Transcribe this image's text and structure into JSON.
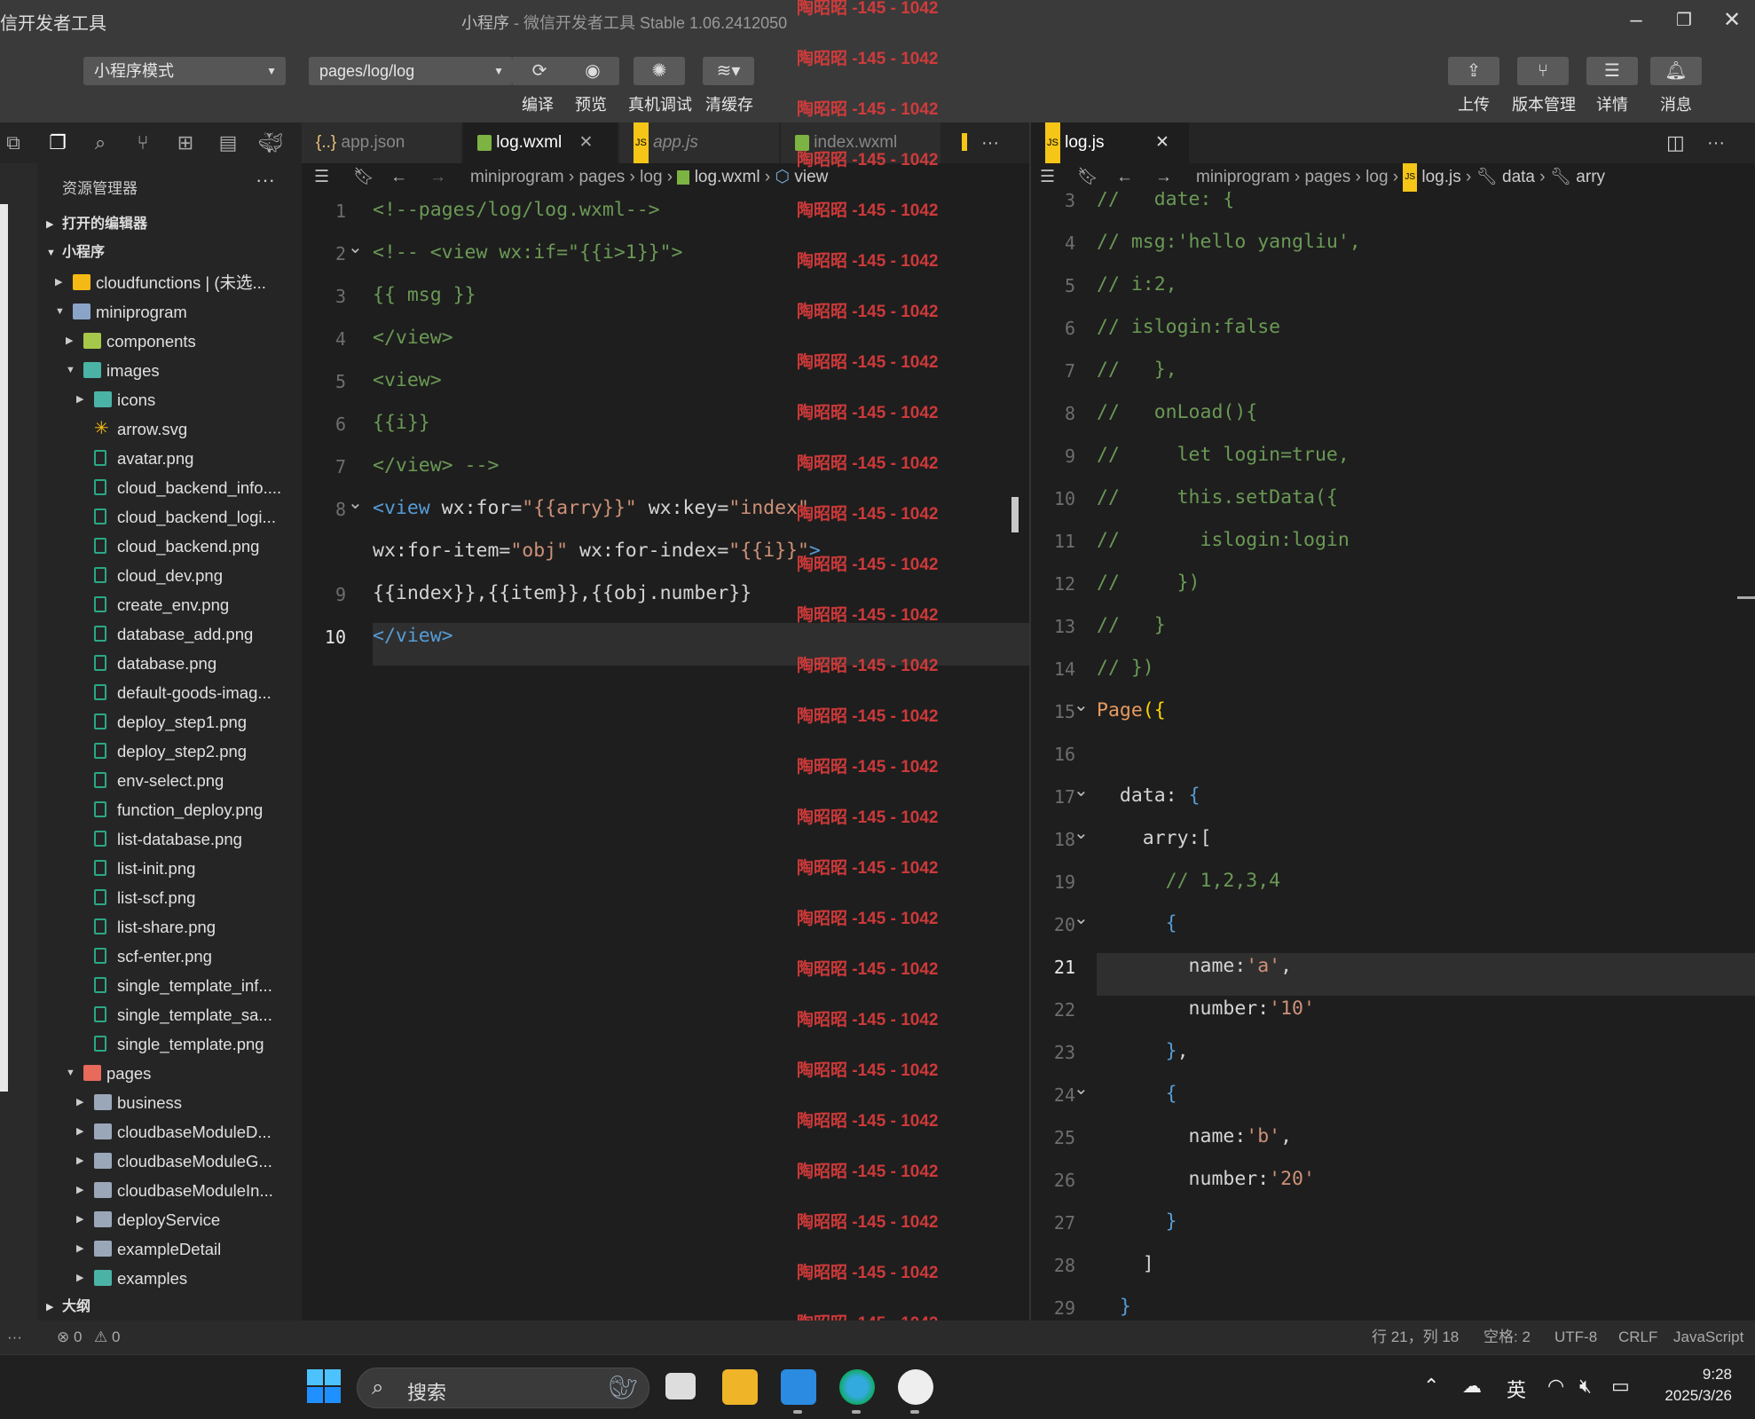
{
  "window": {
    "app_name": "信开发者工具",
    "title_main": "小程序",
    "title_sep": " - ",
    "title_sub": "微信开发者工具 Stable 1.06.2412050"
  },
  "toolbar": {
    "mode_select": "小程序模式",
    "page_select": "pages/log/log",
    "left_buttons": [
      {
        "label": "编译",
        "icon": "refresh-icon"
      },
      {
        "label": "预览",
        "icon": "eye-icon"
      },
      {
        "label": "真机调试",
        "icon": "bug-icon"
      },
      {
        "label": "清缓存",
        "icon": "layers-icon"
      }
    ],
    "right_buttons": [
      {
        "label": "上传",
        "icon": "upload-icon"
      },
      {
        "label": "版本管理",
        "icon": "branch-icon"
      },
      {
        "label": "详情",
        "icon": "menu-icon"
      },
      {
        "label": "消息",
        "icon": "bell-icon"
      }
    ]
  },
  "sidebar": {
    "title": "资源管理器",
    "more": "···",
    "open_editors": "打开的编辑器",
    "project": "小程序",
    "outline": "大纲",
    "tree": [
      {
        "label": "cloudfunctions | (未选...",
        "depth": 1,
        "twisty": "▶",
        "icon": "folder-yellow"
      },
      {
        "label": "miniprogram",
        "depth": 1,
        "twisty": "▼",
        "icon": "folder-open"
      },
      {
        "label": "components",
        "depth": 2,
        "twisty": "▶",
        "icon": "folder-green"
      },
      {
        "label": "images",
        "depth": 2,
        "twisty": "▼",
        "icon": "folder-teal"
      },
      {
        "label": "icons",
        "depth": 3,
        "twisty": "▶",
        "icon": "folder-teal"
      },
      {
        "label": "arrow.svg",
        "depth": 3,
        "twisty": "",
        "icon": "svg"
      },
      {
        "label": "avatar.png",
        "depth": 3,
        "twisty": "",
        "icon": "image"
      },
      {
        "label": "cloud_backend_info....",
        "depth": 3,
        "twisty": "",
        "icon": "image"
      },
      {
        "label": "cloud_backend_logi...",
        "depth": 3,
        "twisty": "",
        "icon": "image"
      },
      {
        "label": "cloud_backend.png",
        "depth": 3,
        "twisty": "",
        "icon": "image"
      },
      {
        "label": "cloud_dev.png",
        "depth": 3,
        "twisty": "",
        "icon": "image"
      },
      {
        "label": "create_env.png",
        "depth": 3,
        "twisty": "",
        "icon": "image"
      },
      {
        "label": "database_add.png",
        "depth": 3,
        "twisty": "",
        "icon": "image"
      },
      {
        "label": "database.png",
        "depth": 3,
        "twisty": "",
        "icon": "image"
      },
      {
        "label": "default-goods-imag...",
        "depth": 3,
        "twisty": "",
        "icon": "image"
      },
      {
        "label": "deploy_step1.png",
        "depth": 3,
        "twisty": "",
        "icon": "image"
      },
      {
        "label": "deploy_step2.png",
        "depth": 3,
        "twisty": "",
        "icon": "image"
      },
      {
        "label": "env-select.png",
        "depth": 3,
        "twisty": "",
        "icon": "image"
      },
      {
        "label": "function_deploy.png",
        "depth": 3,
        "twisty": "",
        "icon": "image"
      },
      {
        "label": "list-database.png",
        "depth": 3,
        "twisty": "",
        "icon": "image"
      },
      {
        "label": "list-init.png",
        "depth": 3,
        "twisty": "",
        "icon": "image"
      },
      {
        "label": "list-scf.png",
        "depth": 3,
        "twisty": "",
        "icon": "image"
      },
      {
        "label": "list-share.png",
        "depth": 3,
        "twisty": "",
        "icon": "image"
      },
      {
        "label": "scf-enter.png",
        "depth": 3,
        "twisty": "",
        "icon": "image"
      },
      {
        "label": "single_template_inf...",
        "depth": 3,
        "twisty": "",
        "icon": "image"
      },
      {
        "label": "single_template_sa...",
        "depth": 3,
        "twisty": "",
        "icon": "image"
      },
      {
        "label": "single_template.png",
        "depth": 3,
        "twisty": "",
        "icon": "image"
      },
      {
        "label": "pages",
        "depth": 2,
        "twisty": "▼",
        "icon": "folder-red"
      },
      {
        "label": "business",
        "depth": 3,
        "twisty": "▶",
        "icon": "folder"
      },
      {
        "label": "cloudbaseModuleD...",
        "depth": 3,
        "twisty": "▶",
        "icon": "folder"
      },
      {
        "label": "cloudbaseModuleG...",
        "depth": 3,
        "twisty": "▶",
        "icon": "folder"
      },
      {
        "label": "cloudbaseModuleIn...",
        "depth": 3,
        "twisty": "▶",
        "icon": "folder"
      },
      {
        "label": "deployService",
        "depth": 3,
        "twisty": "▶",
        "icon": "folder"
      },
      {
        "label": "exampleDetail",
        "depth": 3,
        "twisty": "▶",
        "icon": "folder"
      },
      {
        "label": "examples",
        "depth": 3,
        "twisty": "▶",
        "icon": "folder-teal"
      }
    ]
  },
  "left_editor": {
    "tabs": [
      {
        "label": "app.json",
        "icon": "{..}"
      },
      {
        "label": "log.wxml",
        "icon": "wxml",
        "close": "✕"
      },
      {
        "label": "app.js",
        "icon": "JS"
      },
      {
        "label": "index.wxml",
        "icon": "wxml"
      }
    ],
    "more": "···",
    "breadcrumbs": [
      "miniprogram",
      "pages",
      "log",
      "log.wxml",
      "view"
    ],
    "lines": [
      {
        "n": "1",
        "parts": [
          [
            "c-cm",
            "<!--pages/log/log.wxml-->"
          ]
        ]
      },
      {
        "n": "2",
        "parts": [
          [
            "c-cm",
            "<!-- <view wx:if=\"{{i>1}}\">"
          ]
        ]
      },
      {
        "n": "3",
        "parts": [
          [
            "c-cm",
            "{{ msg }}"
          ]
        ]
      },
      {
        "n": "4",
        "parts": [
          [
            "c-cm",
            "</view>"
          ]
        ]
      },
      {
        "n": "5",
        "parts": [
          [
            "c-cm",
            "<view>"
          ]
        ]
      },
      {
        "n": "6",
        "parts": [
          [
            "c-cm",
            "{{i}}"
          ]
        ]
      },
      {
        "n": "7",
        "parts": [
          [
            "c-cm",
            "</view> -->"
          ]
        ]
      },
      {
        "n": "8",
        "parts": [
          [
            "c-tag",
            "<view"
          ],
          [
            "c-def",
            " wx:for="
          ],
          [
            "c-str",
            "\"{{arry}}\""
          ],
          [
            "c-def",
            " wx:key="
          ],
          [
            "c-str",
            "\"index\""
          ]
        ]
      },
      {
        "n": "",
        "parts": [
          [
            "c-def",
            "wx:for-item="
          ],
          [
            "c-str",
            "\"obj\""
          ],
          [
            "c-def",
            " wx:for-index="
          ],
          [
            "c-str",
            "\"{{i}}\""
          ],
          [
            "c-tag",
            ">"
          ]
        ]
      },
      {
        "n": "9",
        "parts": [
          [
            "c-def",
            "{{index}},{{item}},{{obj.number}}"
          ]
        ]
      },
      {
        "n": "10",
        "parts": [
          [
            "c-tag",
            "</view>"
          ]
        ]
      }
    ]
  },
  "right_editor": {
    "tab": {
      "label": "log.js",
      "icon": "JS",
      "close": "✕"
    },
    "breadcrumbs": [
      "miniprogram",
      "pages",
      "log",
      "log.js",
      "data",
      "arry"
    ],
    "lines": [
      {
        "n": "3",
        "parts": [
          [
            "c-cm",
            "//   date: {"
          ]
        ]
      },
      {
        "n": "4",
        "parts": [
          [
            "c-cm",
            "// msg:'hello yangliu',"
          ]
        ]
      },
      {
        "n": "5",
        "parts": [
          [
            "c-cm",
            "// i:2,"
          ]
        ]
      },
      {
        "n": "6",
        "parts": [
          [
            "c-cm",
            "// islogin:false"
          ]
        ]
      },
      {
        "n": "7",
        "parts": [
          [
            "c-cm",
            "//   },"
          ]
        ]
      },
      {
        "n": "8",
        "parts": [
          [
            "c-cm",
            "//   onLoad(){"
          ]
        ]
      },
      {
        "n": "9",
        "parts": [
          [
            "c-cm",
            "//     let login=true,"
          ]
        ]
      },
      {
        "n": "10",
        "parts": [
          [
            "c-cm",
            "//     this.setData({"
          ]
        ]
      },
      {
        "n": "11",
        "parts": [
          [
            "c-cm",
            "//       islogin:login"
          ]
        ]
      },
      {
        "n": "12",
        "parts": [
          [
            "c-cm",
            "//     })"
          ]
        ]
      },
      {
        "n": "13",
        "parts": [
          [
            "c-cm",
            "//   }"
          ]
        ]
      },
      {
        "n": "14",
        "parts": [
          [
            "c-cm",
            "// })"
          ]
        ]
      },
      {
        "n": "15",
        "parts": [
          [
            "c-or",
            "Page"
          ],
          [
            "c-brk",
            "({"
          ]
        ]
      },
      {
        "n": "16",
        "parts": [
          [
            "c-def",
            ""
          ]
        ]
      },
      {
        "n": "17",
        "parts": [
          [
            "c-def",
            "  data"
          ],
          [
            "c-def",
            ": "
          ],
          [
            "c-tag",
            "{"
          ]
        ]
      },
      {
        "n": "18",
        "parts": [
          [
            "c-def",
            "    arry:["
          ]
        ]
      },
      {
        "n": "19",
        "parts": [
          [
            "c-cm",
            "      // 1,2,3,4"
          ]
        ]
      },
      {
        "n": "20",
        "parts": [
          [
            "c-tag",
            "      {"
          ]
        ]
      },
      {
        "n": "21",
        "parts": [
          [
            "c-def",
            "        name:"
          ],
          [
            "c-str",
            "'a'"
          ],
          [
            "c-def",
            ","
          ]
        ]
      },
      {
        "n": "22",
        "parts": [
          [
            "c-def",
            "        number:"
          ],
          [
            "c-str",
            "'10'"
          ]
        ]
      },
      {
        "n": "23",
        "parts": [
          [
            "c-tag",
            "      }"
          ],
          [
            "c-def",
            ","
          ]
        ]
      },
      {
        "n": "24",
        "parts": [
          [
            "c-tag",
            "      {"
          ]
        ]
      },
      {
        "n": "25",
        "parts": [
          [
            "c-def",
            "        name:"
          ],
          [
            "c-str",
            "'b'"
          ],
          [
            "c-def",
            ","
          ]
        ]
      },
      {
        "n": "26",
        "parts": [
          [
            "c-def",
            "        number:"
          ],
          [
            "c-str",
            "'20'"
          ]
        ]
      },
      {
        "n": "27",
        "parts": [
          [
            "c-tag",
            "      }"
          ]
        ]
      },
      {
        "n": "28",
        "parts": [
          [
            "c-def",
            "    ]"
          ]
        ]
      },
      {
        "n": "29",
        "parts": [
          [
            "c-tag",
            "  }"
          ]
        ]
      }
    ]
  },
  "watermark": "陶昭昭 -145 - 1042",
  "statusbar": {
    "more": "···",
    "errors": "⊗ 0",
    "warnings": "⚠ 0",
    "position": "行 21，列 18",
    "indent": "空格: 2",
    "encoding": "UTF-8",
    "eol": "CRLF",
    "language": "JavaScript"
  },
  "taskbar": {
    "search": "搜索",
    "ime": "英",
    "time": "9:28",
    "date": "2025/3/26"
  },
  "colors": {
    "accent": "#569cd6",
    "comment": "#6a9955",
    "string": "#ce9178",
    "watermark": "#e03c3c"
  }
}
